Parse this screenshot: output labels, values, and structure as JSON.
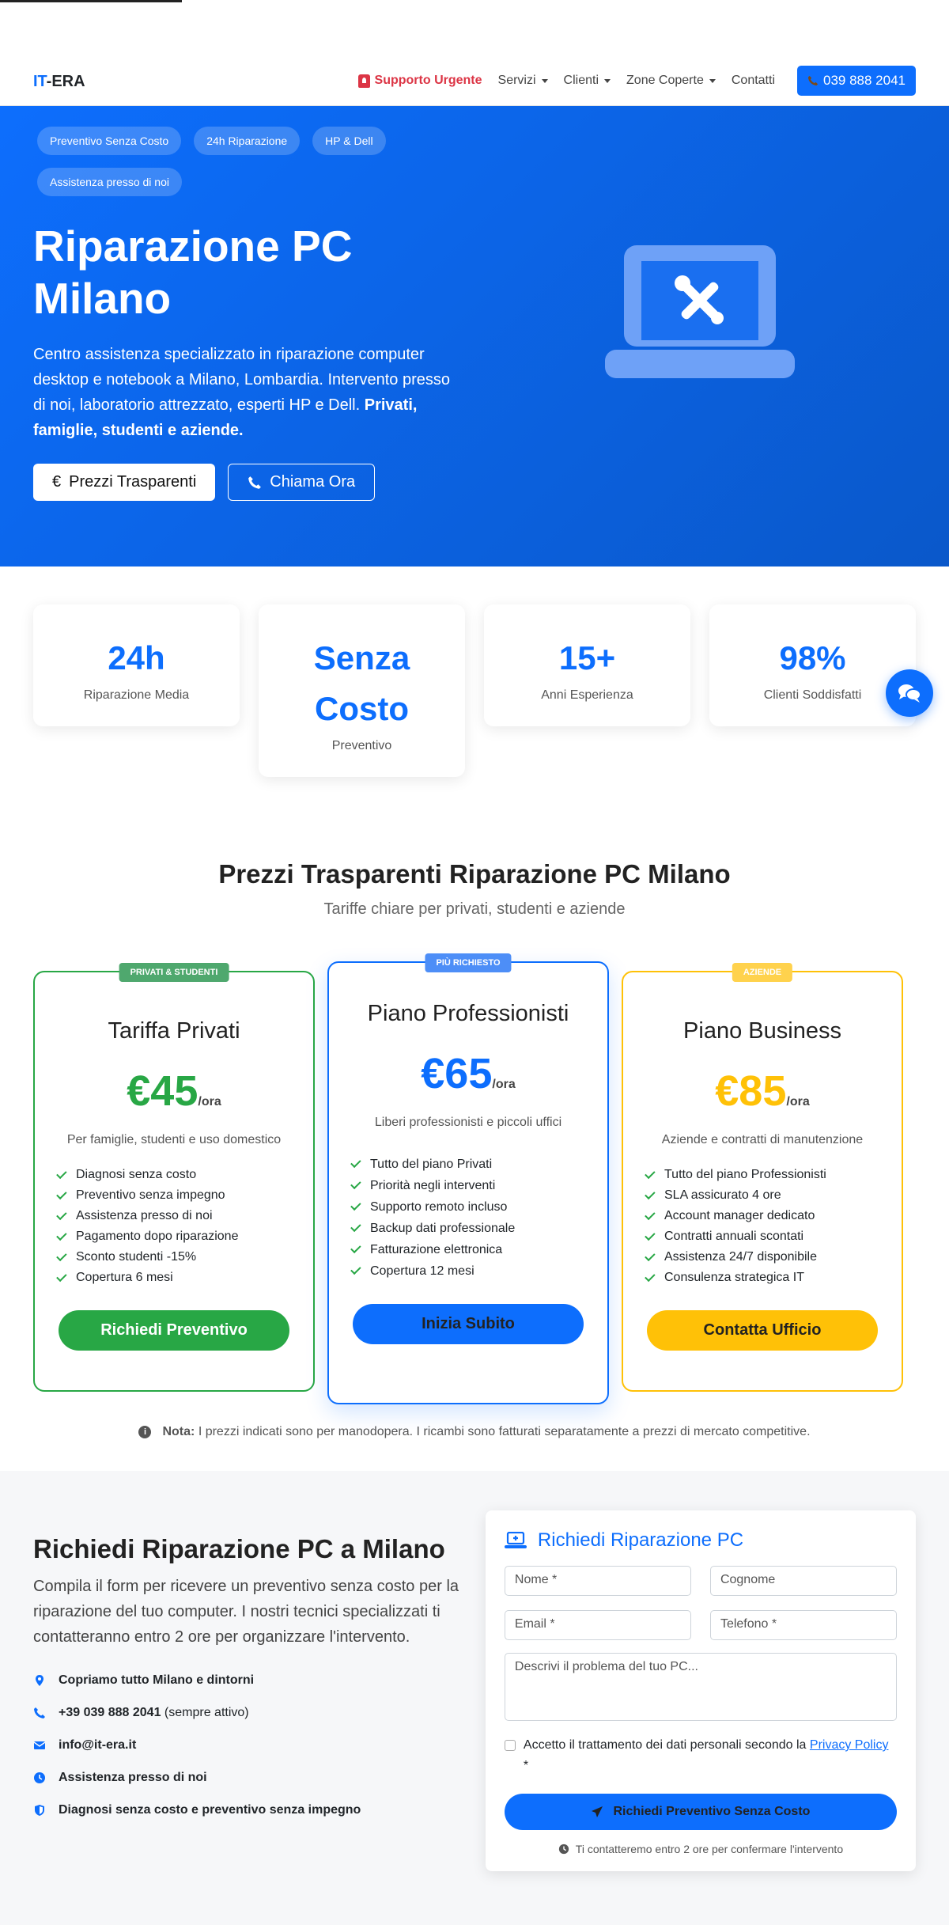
{
  "nav": {
    "brand_it": "IT",
    "brand_rest": "-ERA",
    "urgent": "Supporto Urgente",
    "servizi": "Servizi",
    "clienti": "Clienti",
    "zone": "Zone Coperte",
    "contatti": "Contatti",
    "phone": "039 888 2041"
  },
  "hero": {
    "badges": [
      "Preventivo Senza Costo",
      "24h Riparazione",
      "HP & Dell",
      "Assistenza presso di noi"
    ],
    "title": "Riparazione PC Milano",
    "text": "Centro assistenza specializzato in riparazione computer desktop e notebook a Milano, Lombardia. Intervento presso di noi, laboratorio attrezzato, esperti HP e Dell.",
    "text_strong": "Privati, famiglie, studenti e aziende.",
    "btn_prices": "Prezzi Trasparenti",
    "btn_call": "Chiama Ora",
    "euro_symbol": "€"
  },
  "stats": [
    {
      "value": "24h",
      "label": "Riparazione Media"
    },
    {
      "value": "Senza Costo",
      "label": "Preventivo"
    },
    {
      "value": "15+",
      "label": "Anni Esperienza"
    },
    {
      "value": "98%",
      "label": "Clienti Soddisfatti"
    }
  ],
  "pricing": {
    "title": "Prezzi Trasparenti Riparazione PC Milano",
    "subtitle": "Tariffe chiare per privati, studenti e aziende",
    "plans": [
      {
        "tag": "PRIVATI & STUDENTI",
        "name": "Tariffa Privati",
        "price": "€45",
        "per": "/ora",
        "desc": "Per famiglie, studenti e uso domestico",
        "features": [
          "Diagnosi senza costo",
          "Preventivo senza impegno",
          "Assistenza presso di noi",
          "Pagamento dopo riparazione",
          "Sconto studenti -15%",
          "Copertura 6 mesi"
        ],
        "button": "Richiedi Preventivo"
      },
      {
        "tag": "PIÙ RICHIESTO",
        "name": "Piano Professionisti",
        "price": "€65",
        "per": "/ora",
        "desc": "Liberi professionisti e piccoli uffici",
        "features": [
          "Tutto del piano Privati",
          "Priorità negli interventi",
          "Supporto remoto incluso",
          "Backup dati professionale",
          "Fatturazione elettronica",
          "Copertura 12 mesi"
        ],
        "button": "Inizia Subito"
      },
      {
        "tag": "AZIENDE",
        "name": "Piano Business",
        "price": "€85",
        "per": "/ora",
        "desc": "Aziende e contratti di manutenzione",
        "features": [
          "Tutto del piano Professionisti",
          "SLA assicurato 4 ore",
          "Account manager dedicato",
          "Contratti annuali scontati",
          "Assistenza 24/7 disponibile",
          "Consulenza strategica IT"
        ],
        "button": "Contatta Ufficio"
      }
    ],
    "note_label": "Nota:",
    "note_text": "I prezzi indicati sono per manodopera. I ricambi sono fatturati separatamente a prezzi di mercato competitive."
  },
  "contact": {
    "title": "Richiedi Riparazione PC a Milano",
    "text": "Compila il form per ricevere un preventivo senza costo per la riparazione del tuo computer. I nostri tecnici specializzati ti contatteranno entro 2 ore per organizzare l'intervento.",
    "items": [
      {
        "strong": "Copriamo tutto Milano e dintorni",
        "rest": ""
      },
      {
        "strong": "+39 039 888 2041",
        "rest": " (sempre attivo)"
      },
      {
        "strong": "info@it-era.it",
        "rest": ""
      },
      {
        "strong": "Assistenza presso di noi",
        "rest": ""
      },
      {
        "strong": "Diagnosi senza costo e preventivo senza impegno",
        "rest": ""
      }
    ]
  },
  "form": {
    "title": "Richiedi Riparazione PC",
    "nome": "Nome *",
    "cognome": "Cognome",
    "email": "Email *",
    "telefono": "Telefono *",
    "problema": "Descrivi il problema del tuo PC...",
    "consent_text": "Accetto il trattamento dei dati personali secondo la",
    "consent_link": "Privacy Policy",
    "consent_star": " *",
    "submit": "Richiedi Preventivo Senza Costo",
    "note": "Ti contatteremo entro 2 ore per confermare l'intervento"
  }
}
